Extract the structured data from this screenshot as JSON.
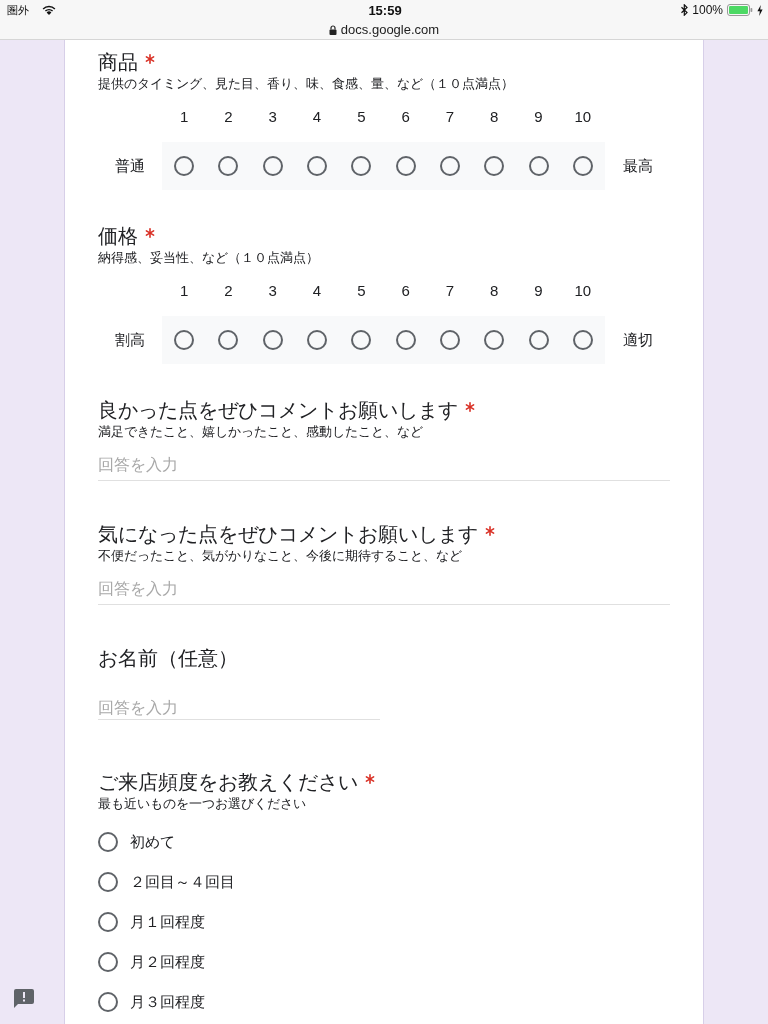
{
  "status_bar": {
    "carrier": "圏外",
    "time": "15:59",
    "url": "docs.google.com",
    "battery": "100%",
    "charging": true
  },
  "questions": [
    {
      "kind": "scale",
      "title": "商品",
      "required": true,
      "description": "提供のタイミング、見た目、香り、味、食感、量、など（１０点満点）",
      "low_label": "普通",
      "high_label": "最高",
      "options": [
        {
          "label": "1",
          "selected": false
        },
        {
          "label": "2",
          "selected": false
        },
        {
          "label": "3",
          "selected": false
        },
        {
          "label": "4",
          "selected": false
        },
        {
          "label": "5",
          "selected": false
        },
        {
          "label": "6",
          "selected": false
        },
        {
          "label": "7",
          "selected": false
        },
        {
          "label": "8",
          "selected": false
        },
        {
          "label": "9",
          "selected": false
        },
        {
          "label": "10",
          "selected": false
        }
      ]
    },
    {
      "kind": "scale",
      "title": "価格",
      "required": true,
      "description": "納得感、妥当性、など（１０点満点）",
      "low_label": "割高",
      "high_label": "適切",
      "options": [
        {
          "label": "1",
          "selected": false
        },
        {
          "label": "2",
          "selected": false
        },
        {
          "label": "3",
          "selected": false
        },
        {
          "label": "4",
          "selected": false
        },
        {
          "label": "5",
          "selected": false
        },
        {
          "label": "6",
          "selected": false
        },
        {
          "label": "7",
          "selected": false
        },
        {
          "label": "8",
          "selected": false
        },
        {
          "label": "9",
          "selected": false
        },
        {
          "label": "10",
          "selected": false
        }
      ]
    },
    {
      "kind": "paragraph",
      "title": "良かった点をぜひコメントお願いします",
      "required": true,
      "description": "満足できたこと、嬉しかったこと、感動したこと、など",
      "placeholder": "回答を入力"
    },
    {
      "kind": "paragraph",
      "title": "気になった点をぜひコメントお願いします",
      "required": true,
      "description": "不便だったこと、気がかりなこと、今後に期待すること、など",
      "placeholder": "回答を入力"
    },
    {
      "kind": "short_text",
      "title": "お名前（任意）",
      "required": false,
      "placeholder": "回答を入力"
    },
    {
      "kind": "choice",
      "title": "ご来店頻度をお教えください",
      "required": true,
      "description": "最も近いものを一つお選びください",
      "options": [
        {
          "label": "初めて",
          "selected": false
        },
        {
          "label": "２回目～４回目",
          "selected": false
        },
        {
          "label": "月１回程度",
          "selected": false
        },
        {
          "label": "月２回程度",
          "selected": false
        },
        {
          "label": "月３回程度",
          "selected": false
        }
      ]
    }
  ]
}
